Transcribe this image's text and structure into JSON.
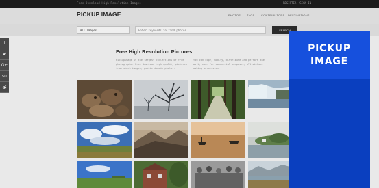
{
  "topbar": {
    "tagline": "Free Download High Resolution Images",
    "links": [
      "REGISTER",
      "SIGN IN"
    ]
  },
  "header": {
    "logo": "PICKUP IMAGE",
    "nav": [
      "PHOTOS",
      "TAGS",
      "CONTRIBUTORS",
      "DESTINATIONS"
    ]
  },
  "search": {
    "select_value": "All Images",
    "placeholder": "Enter keywords to find photos",
    "button_label": "SEARCH"
  },
  "social": [
    "f",
    "t",
    "G+",
    "su",
    "r"
  ],
  "intro": {
    "title": "Free High Resolution Pictures",
    "left_paragraph": "PickupImage is the largest collections of free photographs. Free download high quality pictures from stock images, public domain photos.",
    "right_paragraph": "You can copy, modify, distribute and perform the work, even for commercial purposes, all without asking permission."
  },
  "gallery": [
    {
      "label": "photo-otters"
    },
    {
      "label": "photo-bare-tree-fog"
    },
    {
      "label": "photo-forest-path"
    },
    {
      "label": "photo-glacier"
    },
    {
      "label": "photo-field-sky"
    },
    {
      "label": "photo-mountain-valley"
    },
    {
      "label": "photo-sunset-boats"
    },
    {
      "label": "photo-lake-island"
    },
    {
      "label": "photo-blue-sky-field"
    },
    {
      "label": "photo-brick-house"
    },
    {
      "label": "photo-crowd"
    },
    {
      "label": "photo-mountain-lake"
    }
  ],
  "popup": {
    "title_line1": "PICKUP",
    "title_line2": "IMAGE",
    "colors": {
      "panel": "#0a3fbf",
      "panel_top": "#1650dd"
    }
  }
}
